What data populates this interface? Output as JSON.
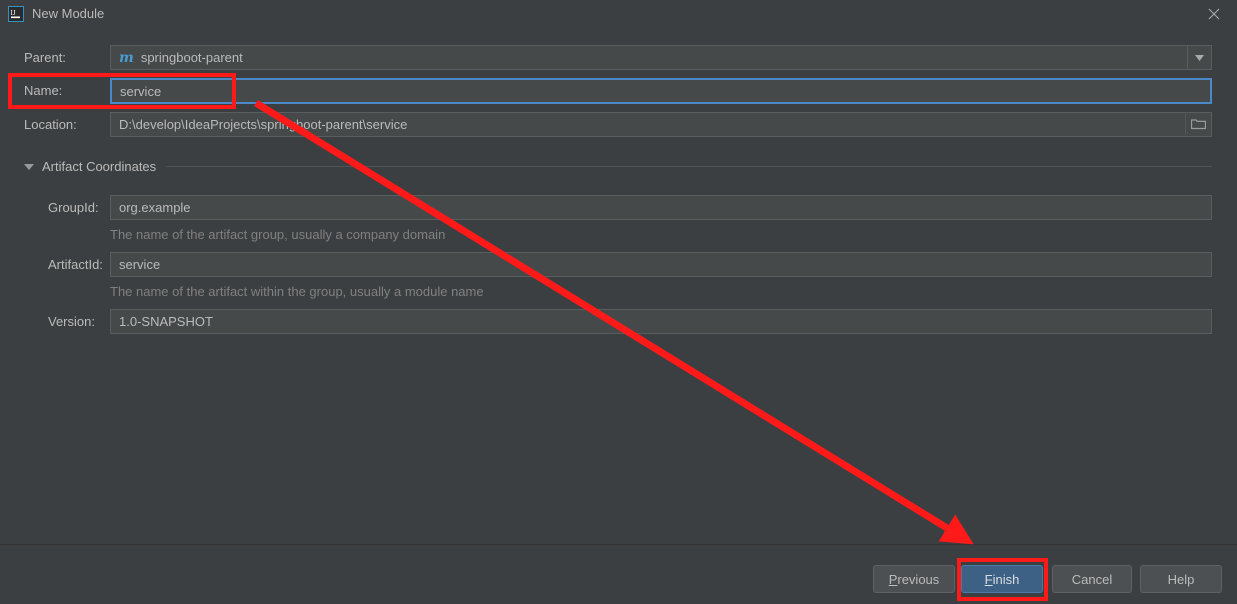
{
  "window": {
    "title": "New Module",
    "app_icon": "intellij-idea-icon",
    "close_icon": "close-icon",
    "background_color": "#3c3f41"
  },
  "form": {
    "parent": {
      "label": "Parent:",
      "value": "springboot-parent",
      "icon": "maven-module-icon",
      "icon_glyph": "m",
      "dropdown_icon": "chevron-down-icon"
    },
    "name": {
      "label": "Name:",
      "value": "service",
      "focused": true
    },
    "location": {
      "label": "Location:",
      "value": "D:\\develop\\IdeaProjects\\springboot-parent\\service",
      "browse_icon": "folder-icon"
    }
  },
  "artifact_coordinates": {
    "section_label": "Artifact Coordinates",
    "expanded": true,
    "collapse_icon": "triangle-down-icon",
    "fields": [
      {
        "label": "GroupId:",
        "value": "org.example",
        "hint": "The name of the artifact group, usually a company domain"
      },
      {
        "label": "ArtifactId:",
        "value": "service",
        "hint": "The name of the artifact within the group, usually a module name"
      },
      {
        "label": "Version:",
        "value": "1.0-SNAPSHOT",
        "hint": ""
      }
    ]
  },
  "buttons": {
    "previous": {
      "label": "Previous",
      "mnemonic": "P",
      "default": false
    },
    "finish": {
      "label": "Finish",
      "mnemonic": "F",
      "default": true
    },
    "cancel": {
      "label": "Cancel",
      "mnemonic": "",
      "default": false
    },
    "help": {
      "label": "Help",
      "mnemonic": "",
      "default": false
    }
  },
  "annotations": {
    "highlight_color": "#ff1a1a",
    "name_row_box": true,
    "finish_button_box": true,
    "arrow": true
  }
}
